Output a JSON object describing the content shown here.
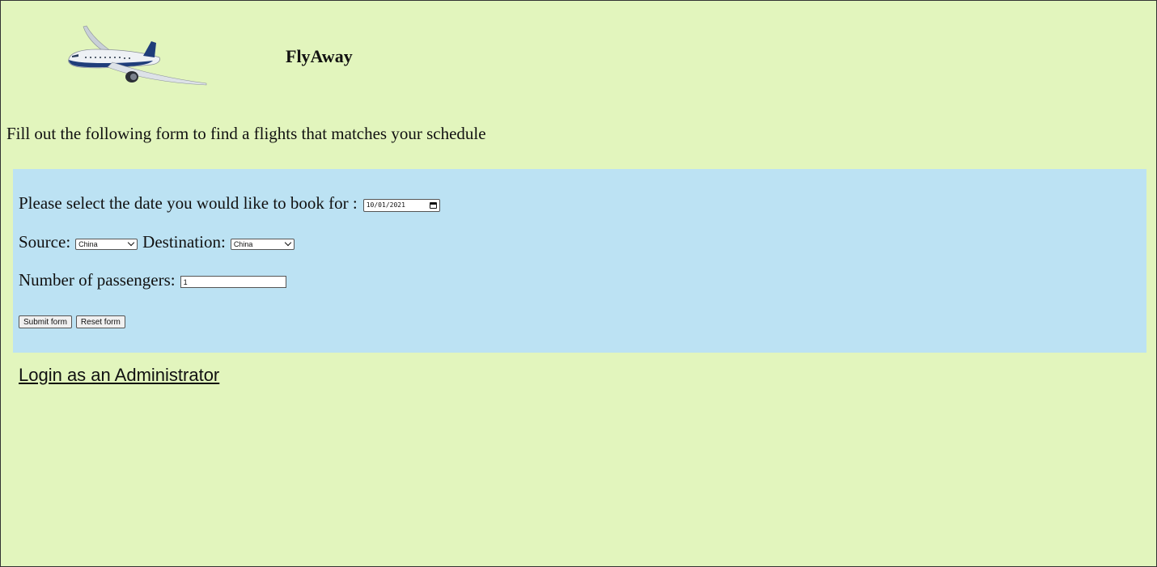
{
  "header": {
    "logo_icon": "airplane-icon",
    "title": "FlyAway"
  },
  "intro": "Fill out the following form to find a flights that matches your schedule",
  "form": {
    "date_label": "Please select the date you would like to book for :",
    "date_value": "10/01/2021",
    "source_label": "Source:",
    "source_value": "China",
    "destination_label": "Destination:",
    "destination_value": "China",
    "passengers_label": "Number of passengers:",
    "passengers_value": "1",
    "submit_label": "Submit form",
    "reset_label": "Reset form"
  },
  "admin_link": "Login as an Administrator",
  "colors": {
    "page_background": "#e2f5bd",
    "form_background": "#bce2f3"
  }
}
